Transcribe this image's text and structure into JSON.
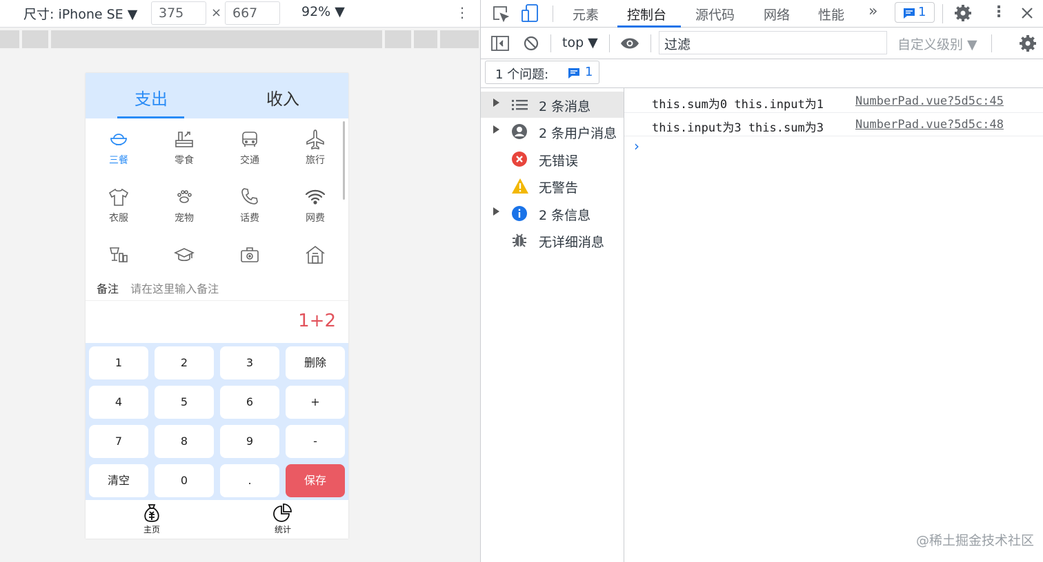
{
  "device_toolbar": {
    "device_label": "尺寸: iPhone SE ▼",
    "width": "375",
    "height": "667",
    "times": "×",
    "zoom": "92% ▼",
    "more": "⋮"
  },
  "phone": {
    "tabs": [
      "支出",
      "收入"
    ],
    "categories": [
      {
        "label": "三餐",
        "icon": "bowl-icon"
      },
      {
        "label": "零食",
        "icon": "snack-icon"
      },
      {
        "label": "交通",
        "icon": "bus-icon"
      },
      {
        "label": "旅行",
        "icon": "airplane-icon"
      },
      {
        "label": "衣服",
        "icon": "tshirt-icon"
      },
      {
        "label": "宠物",
        "icon": "paw-icon"
      },
      {
        "label": "话费",
        "icon": "phone-icon"
      },
      {
        "label": "网费",
        "icon": "wifi-icon"
      },
      {
        "label": "",
        "icon": "drinks-icon"
      },
      {
        "label": "",
        "icon": "graduation-cap-icon"
      },
      {
        "label": "",
        "icon": "medical-kit-icon"
      },
      {
        "label": "",
        "icon": "house-icon"
      }
    ],
    "note_label": "备注",
    "note_placeholder": "请在这里输入备注",
    "expression": "1+2",
    "keys": [
      "1",
      "2",
      "3",
      "删除",
      "4",
      "5",
      "6",
      "+",
      "7",
      "8",
      "9",
      "-",
      "清空",
      "0",
      ".",
      "保存"
    ],
    "nav": [
      "主页",
      "统计"
    ]
  },
  "devtools": {
    "tabs": [
      "元素",
      "控制台",
      "源代码",
      "网络",
      "性能"
    ],
    "more_tabs": "»",
    "issues_badge": "1",
    "context": "top ▼",
    "filter_value": "过滤",
    "levels": "自定义级别 ▼",
    "issues_button_label": "1 个问题:",
    "issues_button_count": "1",
    "sidebar": [
      "2 条消息",
      "2 条用户消息",
      "无错误",
      "无警告",
      "2 条信息",
      "无详细消息"
    ],
    "logs": [
      {
        "message": "this.sum为0 this.input为1",
        "source": "NumberPad.vue?5d5c:45"
      },
      {
        "message": "this.input为3 this.sum为3",
        "source": "NumberPad.vue?5d5c:48"
      }
    ],
    "prompt": "›"
  },
  "watermark": "@稀土掘金技术社区",
  "colors": {
    "accent_blue": "#2a8cf6",
    "save_red": "#ea5a63",
    "pad_bg": "#dbeafe",
    "devtools_blue": "#1a73e8"
  }
}
